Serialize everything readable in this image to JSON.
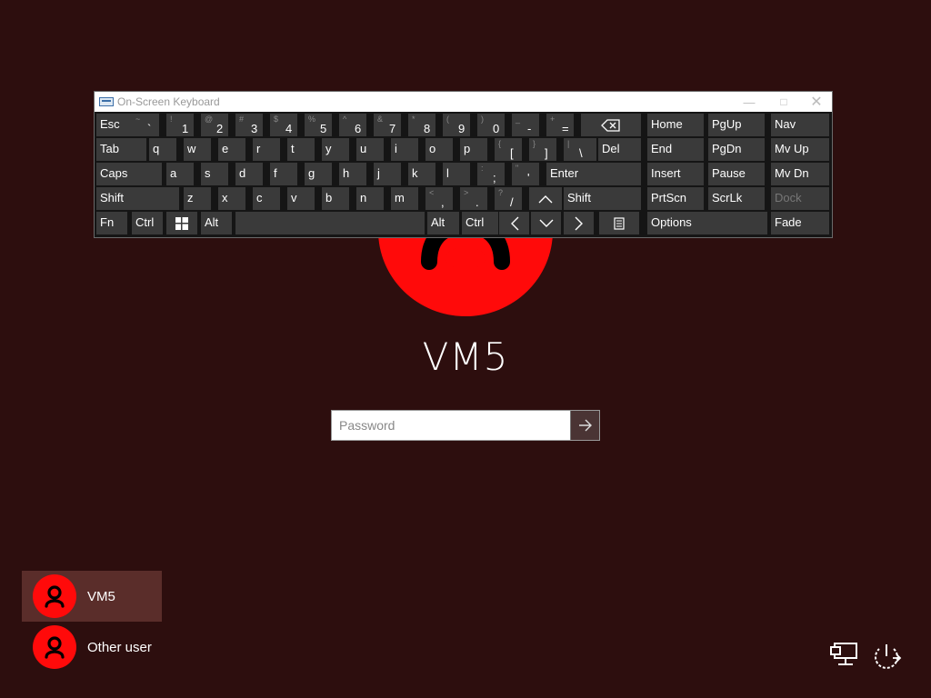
{
  "login": {
    "user_name": "VM5",
    "password_placeholder": "Password"
  },
  "user_list": [
    {
      "name": "VM5",
      "selected": true
    },
    {
      "name": "Other user",
      "selected": false
    }
  ],
  "osk": {
    "title": "On-Screen Keyboard",
    "rows": [
      [
        {
          "l": "Esc"
        },
        {
          "s": "~",
          "p": "`"
        },
        {
          "s": "!",
          "p": "1"
        },
        {
          "s": "@",
          "p": "2"
        },
        {
          "s": "#",
          "p": "3"
        },
        {
          "s": "$",
          "p": "4"
        },
        {
          "s": "%",
          "p": "5"
        },
        {
          "s": "^",
          "p": "6"
        },
        {
          "s": "&",
          "p": "7"
        },
        {
          "s": "*",
          "p": "8"
        },
        {
          "s": "(",
          "p": "9"
        },
        {
          "s": ")",
          "p": "0"
        },
        {
          "s": "_",
          "p": "-"
        },
        {
          "s": "+",
          "p": "="
        },
        {
          "icon": "backspace-icon"
        },
        {
          "l": "Home"
        },
        {
          "l": "PgUp"
        },
        {
          "l": "Nav"
        }
      ],
      [
        {
          "l": "Tab"
        },
        {
          "l": "q"
        },
        {
          "l": "w"
        },
        {
          "l": "e"
        },
        {
          "l": "r"
        },
        {
          "l": "t"
        },
        {
          "l": "y"
        },
        {
          "l": "u"
        },
        {
          "l": "i"
        },
        {
          "l": "o"
        },
        {
          "l": "p"
        },
        {
          "s": "{",
          "p": "["
        },
        {
          "s": "}",
          "p": "]"
        },
        {
          "s": "|",
          "p": "\\"
        },
        {
          "l": "Del"
        },
        {
          "l": "End"
        },
        {
          "l": "PgDn"
        },
        {
          "l": "Mv Up"
        }
      ],
      [
        {
          "l": "Caps"
        },
        {
          "l": "a"
        },
        {
          "l": "s"
        },
        {
          "l": "d"
        },
        {
          "l": "f"
        },
        {
          "l": "g"
        },
        {
          "l": "h"
        },
        {
          "l": "j"
        },
        {
          "l": "k"
        },
        {
          "l": "l"
        },
        {
          "s": ":",
          "p": ";"
        },
        {
          "s": "\"",
          "p": "'"
        },
        {
          "l": "Enter"
        },
        {
          "l": "Insert"
        },
        {
          "l": "Pause"
        },
        {
          "l": "Mv Dn"
        }
      ],
      [
        {
          "l": "Shift"
        },
        {
          "l": "z"
        },
        {
          "l": "x"
        },
        {
          "l": "c"
        },
        {
          "l": "v"
        },
        {
          "l": "b"
        },
        {
          "l": "n"
        },
        {
          "l": "m"
        },
        {
          "s": "<",
          "p": ","
        },
        {
          "s": ">",
          "p": "."
        },
        {
          "s": "?",
          "p": "/"
        },
        {
          "icon": "arrow-up-icon"
        },
        {
          "l": "Shift"
        },
        {
          "l": "PrtScn"
        },
        {
          "l": "ScrLk"
        },
        {
          "l": "Dock",
          "dim": true
        }
      ],
      [
        {
          "l": "Fn"
        },
        {
          "l": "Ctrl"
        },
        {
          "icon": "windows-icon"
        },
        {
          "l": "Alt"
        },
        {
          "l": ""
        },
        {
          "l": "Alt"
        },
        {
          "l": "Ctrl"
        },
        {
          "icon": "arrow-left-icon"
        },
        {
          "icon": "arrow-down-icon"
        },
        {
          "icon": "arrow-right-icon"
        },
        {
          "icon": "context-menu-icon"
        },
        {
          "l": "Options"
        },
        {
          "l": "Fade"
        }
      ]
    ]
  },
  "icons": {
    "network": "network-icon",
    "power": "power-icon"
  },
  "colors": {
    "background": "#2d0e0e",
    "avatar": "#ff0a0a",
    "selected_user": "#5a2d2a",
    "key": "#3a3a3a"
  }
}
